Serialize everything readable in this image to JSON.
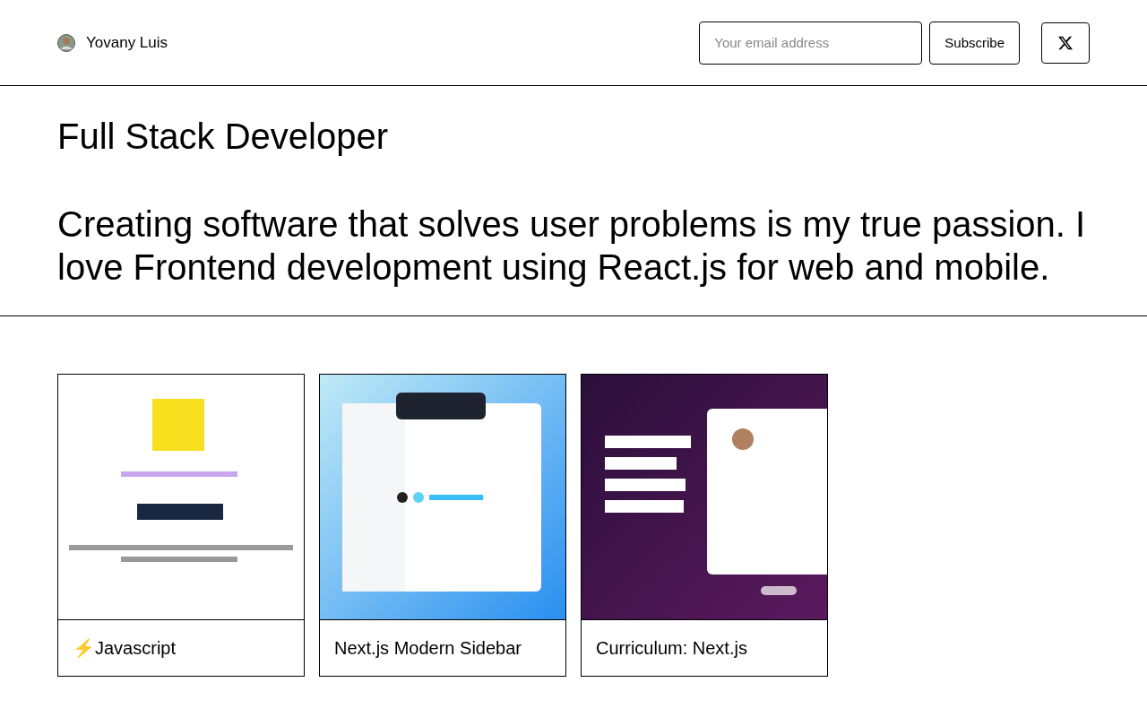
{
  "header": {
    "author": "Yovany Luis",
    "email_field": {
      "placeholder": "Your email address"
    },
    "subscribe_button": "Subscribe"
  },
  "hero": {
    "title": "Full Stack Developer",
    "bio": "Creating software that solves user problems is my true passion. I love Frontend development using React.js for web and mobile."
  },
  "posts": [
    {
      "title": "⚡Javascript"
    },
    {
      "title": "Next.js Modern Sidebar"
    },
    {
      "title": "Curriculum: Next.js"
    }
  ]
}
